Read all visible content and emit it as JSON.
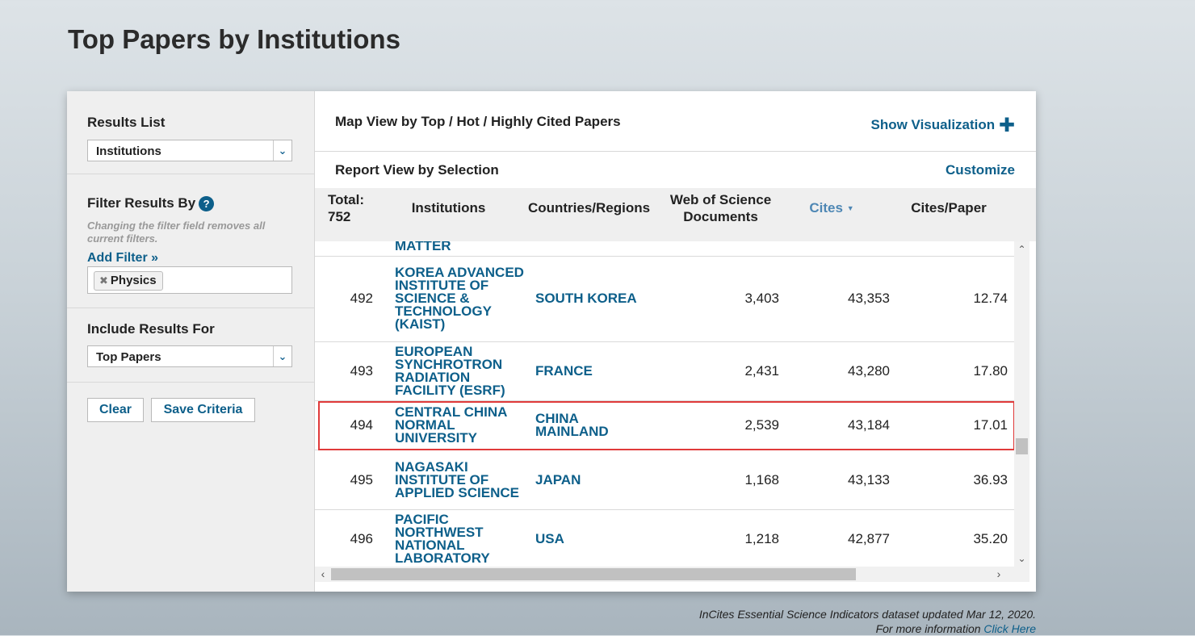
{
  "page_title": "Top Papers by Institutions",
  "sidebar": {
    "results_list_label": "Results List",
    "results_list_value": "Institutions",
    "filter_label": "Filter Results By",
    "help_glyph": "?",
    "filter_note": "Changing the filter field removes all current filters.",
    "add_filter": "Add Filter »",
    "filter_chip": "Physics",
    "include_label": "Include Results For",
    "include_value": "Top Papers",
    "clear_button": "Clear",
    "save_button": "Save Criteria"
  },
  "main": {
    "map_view_title": "Map View by Top / Hot / Highly Cited Papers",
    "show_visualization": "Show Visualization",
    "report_view_title": "Report View by Selection",
    "customize": "Customize",
    "columns": {
      "total": "Total:",
      "total_count": "752",
      "institutions": "Institutions",
      "countries": "Countries/Regions",
      "wos_docs_1": "Web of Science",
      "wos_docs_2": "Documents",
      "cites": "Cites",
      "cites_per_paper": "Cites/Paper"
    },
    "partial_row_text": "MATTER",
    "rows": [
      {
        "rank": "492",
        "institution": "KOREA ADVANCED INSTITUTE OF SCIENCE & TECHNOLOGY (KAIST)",
        "country": "SOUTH KOREA",
        "docs": "3,403",
        "cites": "43,353",
        "cpp": "12.74"
      },
      {
        "rank": "493",
        "institution": "EUROPEAN SYNCHROTRON RADIATION FACILITY (ESRF)",
        "country": "FRANCE",
        "docs": "2,431",
        "cites": "43,280",
        "cpp": "17.80"
      },
      {
        "rank": "494",
        "institution": "CENTRAL CHINA NORMAL UNIVERSITY",
        "country": "CHINA MAINLAND",
        "docs": "2,539",
        "cites": "43,184",
        "cpp": "17.01"
      },
      {
        "rank": "495",
        "institution": "NAGASAKI INSTITUTE OF APPLIED SCIENCE",
        "country": "JAPAN",
        "docs": "1,168",
        "cites": "43,133",
        "cpp": "36.93"
      },
      {
        "rank": "496",
        "institution": "PACIFIC NORTHWEST NATIONAL LABORATORY",
        "country": "USA",
        "docs": "1,218",
        "cites": "42,877",
        "cpp": "35.20"
      }
    ]
  },
  "footer": {
    "line1": "InCites Essential Science Indicators dataset updated Mar 12, 2020.",
    "line2_prefix": "For more information ",
    "line2_link": "Click Here"
  }
}
